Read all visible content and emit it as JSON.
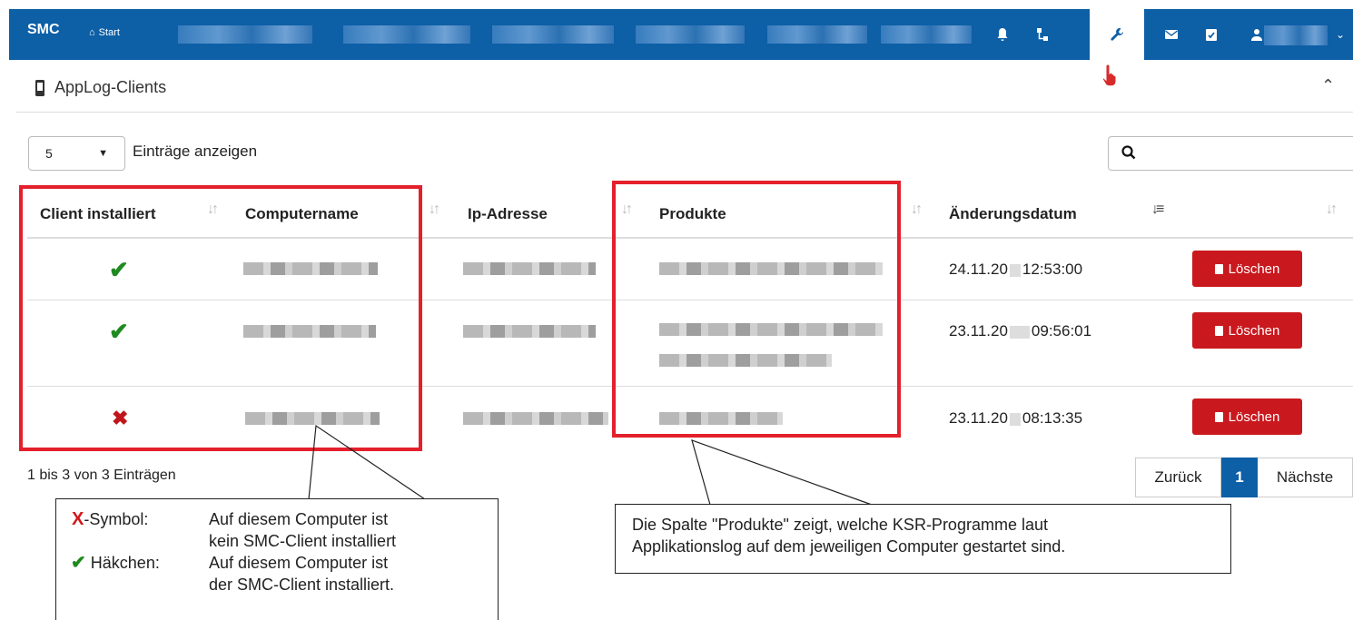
{
  "topbar": {
    "brand": "SMC",
    "start_label": "Start"
  },
  "panel": {
    "title": "AppLog-Clients"
  },
  "controls": {
    "page_length": "5",
    "page_length_label": "Einträge anzeigen"
  },
  "table": {
    "headers": [
      "Client installiert",
      "Computername",
      "Ip-Adresse",
      "Produkte",
      "Änderungsdatum"
    ],
    "rows": [
      {
        "installed": true,
        "date": "24.11.20",
        "time": "12:53:00",
        "action": "Löschen"
      },
      {
        "installed": true,
        "date": "23.11.20",
        "time": "09:56:01",
        "action": "Löschen"
      },
      {
        "installed": false,
        "date": "23.11.20",
        "time": "08:13:35",
        "action": "Löschen"
      }
    ]
  },
  "footer": {
    "info": "1 bis 3 von 3 Einträgen",
    "prev": "Zurück",
    "current_page": "1",
    "next": "Nächste"
  },
  "callout_left": {
    "x_symbol_letter": "X",
    "x_symbol_label": "-Symbol:",
    "x_text_1": "Auf diesem Computer ist",
    "x_text_2": "kein SMC-Client installiert",
    "check_label": "Häkchen:",
    "check_text_1": "Auf diesem Computer ist",
    "check_text_2": "der SMC-Client installiert."
  },
  "callout_right": {
    "line_1": "Die Spalte \"Produkte\" zeigt, welche KSR-Programme laut",
    "line_2": "Applikationslog auf dem jeweiligen Computer gestartet sind."
  },
  "colors": {
    "nav": "#0d5fa6",
    "highlight": "#e3202c",
    "delete": "#c9191e",
    "check": "#1f8a1f",
    "cross": "#c0151b"
  }
}
